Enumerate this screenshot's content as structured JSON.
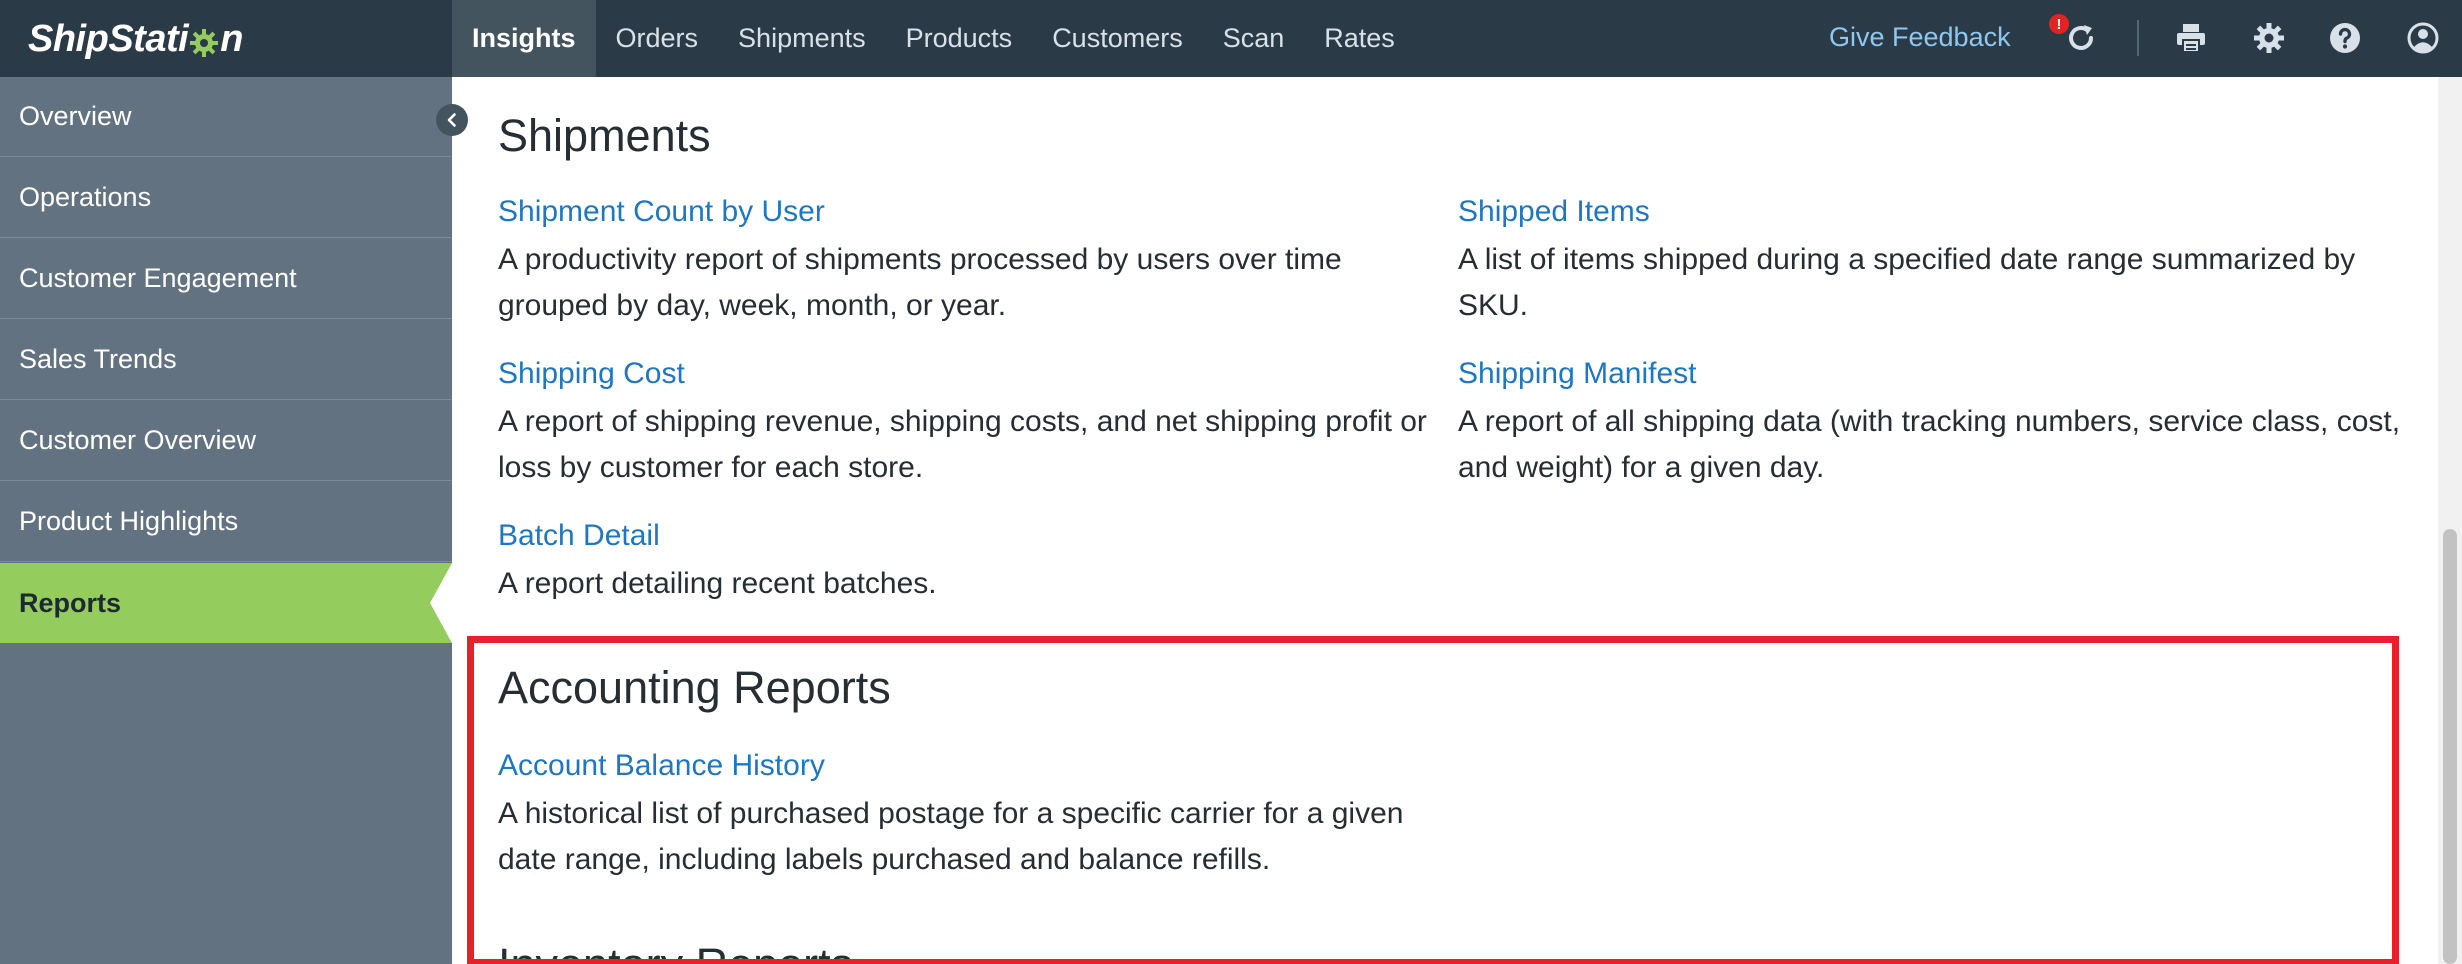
{
  "app": {
    "logo_pre": "ShipStati",
    "logo_post": "n"
  },
  "nav": {
    "items": [
      {
        "label": "Insights"
      },
      {
        "label": "Orders"
      },
      {
        "label": "Shipments"
      },
      {
        "label": "Products"
      },
      {
        "label": "Customers"
      },
      {
        "label": "Scan"
      },
      {
        "label": "Rates"
      }
    ],
    "active": "Insights",
    "feedback_label": "Give Feedback",
    "badge": "!"
  },
  "icons": {
    "refresh": "refresh-icon",
    "print": "printer-icon",
    "settings": "gear-icon",
    "help": "help-icon",
    "account": "user-icon"
  },
  "sidebar": {
    "items": [
      {
        "label": "Overview"
      },
      {
        "label": "Operations"
      },
      {
        "label": "Customer Engagement"
      },
      {
        "label": "Sales Trends"
      },
      {
        "label": "Customer Overview"
      },
      {
        "label": "Product Highlights"
      },
      {
        "label": "Reports"
      }
    ],
    "active": "Reports"
  },
  "sections": {
    "shipments": {
      "title": "Shipments",
      "reports": [
        {
          "title": "Shipment Count by User",
          "desc": "A productivity report of shipments processed by users over time grouped by day, week, month, or year."
        },
        {
          "title": "Shipped Items",
          "desc": "A list of items shipped during a specified date range summarized by SKU."
        },
        {
          "title": "Shipping Cost",
          "desc": "A report of shipping revenue, shipping costs, and net shipping profit or loss by customer for each store."
        },
        {
          "title": "Shipping Manifest",
          "desc": "A report of all shipping data (with tracking numbers, service class, cost, and weight) for a given day."
        },
        {
          "title": "Batch Detail",
          "desc": "A report detailing recent batches."
        }
      ]
    },
    "accounting": {
      "title": "Accounting Reports",
      "reports": [
        {
          "title": "Account Balance History",
          "desc": "A historical list of purchased postage for a specific carrier for a given date range, including labels purchased and balance refills."
        }
      ]
    },
    "next_partial": {
      "title": "Inventory Reports"
    }
  },
  "colors": {
    "topbar": "#2b3a47",
    "sidebar": "#627280",
    "active_sidebar": "#95cc5e",
    "link": "#1f76c2",
    "highlight": "#e8202a",
    "logo_gear": "#95cc5e"
  }
}
